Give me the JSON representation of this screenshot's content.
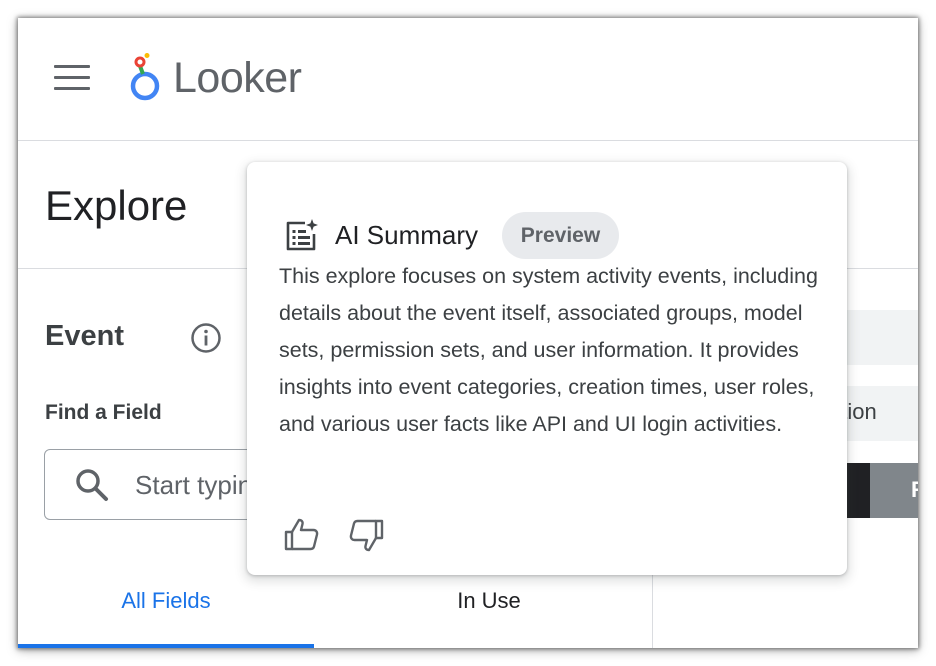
{
  "header": {
    "menu_icon": "hamburger-menu-icon",
    "logo_icon": "looker-logo-icon",
    "logo_text": "Looker",
    "logo_colors": [
      "#4285f4",
      "#ea4335",
      "#fbbc04",
      "#34a853"
    ]
  },
  "explore": {
    "title": "Explore"
  },
  "field_picker": {
    "view_label": "Event",
    "info_icon": "info-icon",
    "find_label": "Find a Field",
    "search_placeholder": "Start typing to search",
    "tabs": [
      {
        "label": "All Fields",
        "active": true
      },
      {
        "label": "In Use",
        "active": false
      }
    ]
  },
  "right_panel": {
    "partial_label": "ation",
    "partial_button_text": "R"
  },
  "ai_summary": {
    "icon": "ai-summary-icon",
    "title": "AI Summary",
    "badge": "Preview",
    "text": "This explore focuses on system activity events, including details about the event itself, associated groups, model sets, permission sets, and user information. It provides insights into event categories, creation times, user roles, and various user facts like API and UI login activities.",
    "feedback": {
      "thumbs_up_icon": "thumbs-up-icon",
      "thumbs_down_icon": "thumbs-down-icon"
    }
  },
  "colors": {
    "accent": "#1a73e8",
    "badge_bg": "#e8eaed",
    "text_primary": "#202124",
    "text_secondary": "#5f6368"
  }
}
